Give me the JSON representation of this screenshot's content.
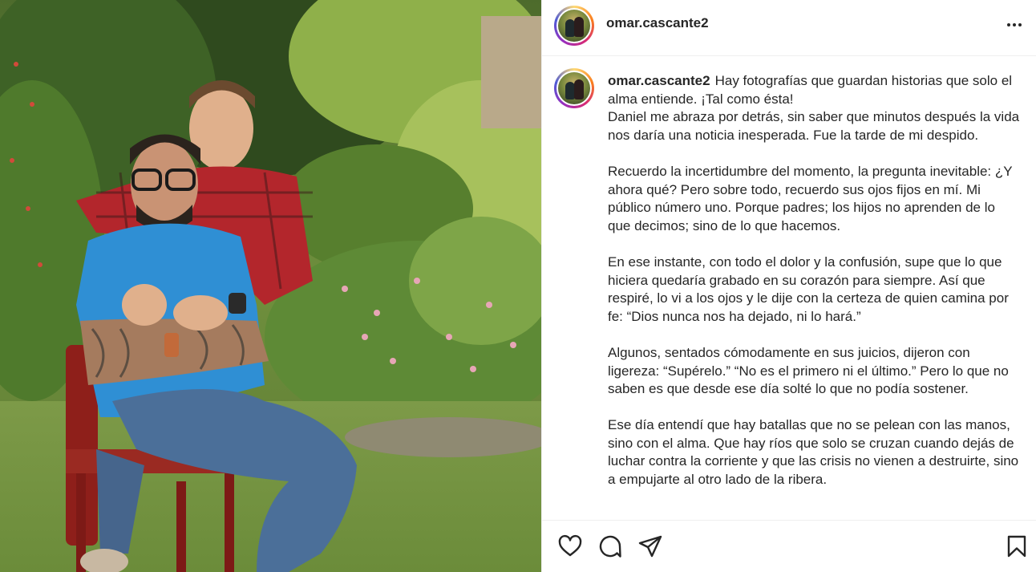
{
  "post": {
    "username": "omar.cascante2",
    "caption_first": "Hay fotografías que guardan historias que solo el alma entiende. ¡Tal como ésta!\nDaniel me abraza por detrás, sin saber que minutos después la vida nos daría una noticia inesperada. Fue la tarde de mi despido.",
    "paragraphs": [
      "Recuerdo la incertidumbre del momento, la pregunta inevitable: ¿Y ahora qué? Pero sobre todo, recuerdo sus ojos fijos en mí. Mi público número uno. Porque padres; los hijos no aprenden de lo que decimos; sino de lo que hacemos.",
      "En ese instante, con todo el dolor y la confusión, supe que lo que hiciera quedaría grabado en su corazón para siempre. Así que respiré, lo vi a los ojos y le dije con la certeza de quien camina por fe: “Dios nunca nos ha dejado, ni lo hará.”",
      "Algunos, sentados cómodamente en sus juicios, dijeron con ligereza: “Supérelo.” “No es el primero ni el último.” Pero lo que no saben es que desde ese día solté lo que no podía sostener.",
      "Ese día entendí que hay batallas que no se pelean con las manos, sino con el alma. Que hay ríos que solo se cruzan cuando dejás de luchar contra la corriente y que las crisis no vienen a destruirte, sino a empujarte al otro lado de la ribera."
    ]
  },
  "icons": {
    "more": "more-options-icon",
    "like": "heart-icon",
    "comment": "comment-icon",
    "share": "share-icon",
    "save": "bookmark-icon"
  },
  "colors": {
    "text": "#262626",
    "border": "#efefef",
    "story_ring": [
      "#feda75",
      "#fa7e1e",
      "#d62976",
      "#962fbf",
      "#4f5bd5"
    ]
  }
}
